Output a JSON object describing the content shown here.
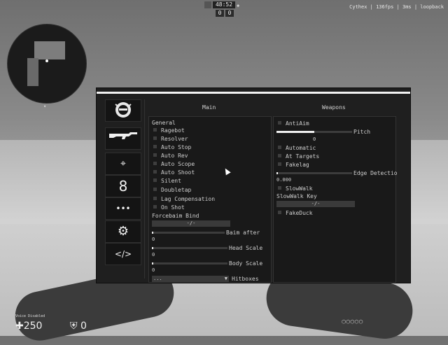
{
  "hud": {
    "timer": "48:52",
    "score_left": "0",
    "score_right": "0",
    "stats_text": "Cythex | 136fps | 3ms | loopback",
    "voice": "Voice Disabled",
    "health": "250",
    "armor": "0"
  },
  "menu": {
    "tabs": [
      {
        "icon": "tiger-logo-icon"
      },
      {
        "icon": "rifle-icon"
      },
      {
        "icon": "crosshair-icon",
        "glyph": "⌖"
      },
      {
        "icon": "eight-icon",
        "glyph": "8"
      },
      {
        "icon": "dots-icon",
        "glyph": "•••"
      },
      {
        "icon": "gear-icon",
        "glyph": "⚙"
      },
      {
        "icon": "code-icon",
        "glyph": "</>"
      }
    ],
    "header_main": "Main",
    "header_weapons": "Weapons",
    "left": {
      "title": "General",
      "checkboxes": [
        "Ragebot",
        "Resolver",
        "Auto Stop",
        "Auto Rev",
        "Auto Scope",
        "Auto Shoot",
        "Silent",
        "Doubletap",
        "Lag Compensation",
        "On Shot"
      ],
      "forcebaim_label": "Forcebaim Bind",
      "forcebaim_value": "-/-",
      "baim_after_label": "Baim after",
      "baim_after_value": "0",
      "head_scale_label": "Head Scale",
      "head_scale_value": "0",
      "body_scale_label": "Body Scale",
      "body_scale_value": "0",
      "hitboxes_label": "Hitboxes",
      "hitboxes_value": "..."
    },
    "right": {
      "antiaim_label": "AntiAim",
      "pitch_label": "Pitch",
      "pitch_value": "0",
      "automatic_label": "Automatic",
      "at_targets_label": "At Targets",
      "fakelag_label": "Fakelag",
      "edge_label": "Edge Detectio",
      "edge_value": "0.000",
      "slowwalk_label": "SlowWalk",
      "slowwalk_key_label": "SlowWalk Key",
      "slowwalk_key_value": "-/-",
      "fakeduck_label": "FakeDuck"
    }
  }
}
